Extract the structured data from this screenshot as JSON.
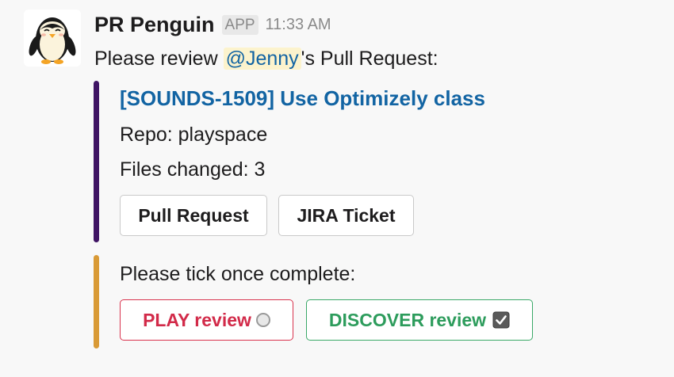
{
  "message": {
    "sender": "PR Penguin",
    "app_badge": "APP",
    "timestamp": "11:33 AM",
    "text_prefix": "Please review ",
    "mention": "@Jenny",
    "text_suffix": "'s Pull Request:"
  },
  "attachment_pr": {
    "bar_color": "#3f1464",
    "title": "[SOUNDS-1509] Use Optimizely class",
    "repo_line": "Repo: playspace",
    "files_line": "Files changed: 3",
    "buttons": [
      {
        "label": "Pull Request"
      },
      {
        "label": "JIRA Ticket"
      }
    ]
  },
  "attachment_review": {
    "bar_color": "#d99a36",
    "prompt": "Please tick once complete:",
    "buttons": [
      {
        "label": "PLAY review",
        "style": "danger",
        "state_icon": "radio-unchecked-icon"
      },
      {
        "label": "DISCOVER review",
        "style": "success",
        "state_icon": "checkbox-checked-icon"
      }
    ]
  },
  "colors": {
    "link": "#1264a3",
    "mention_bg": "#fcf3cd",
    "danger": "#d22a49",
    "success": "#2d9c5c"
  }
}
